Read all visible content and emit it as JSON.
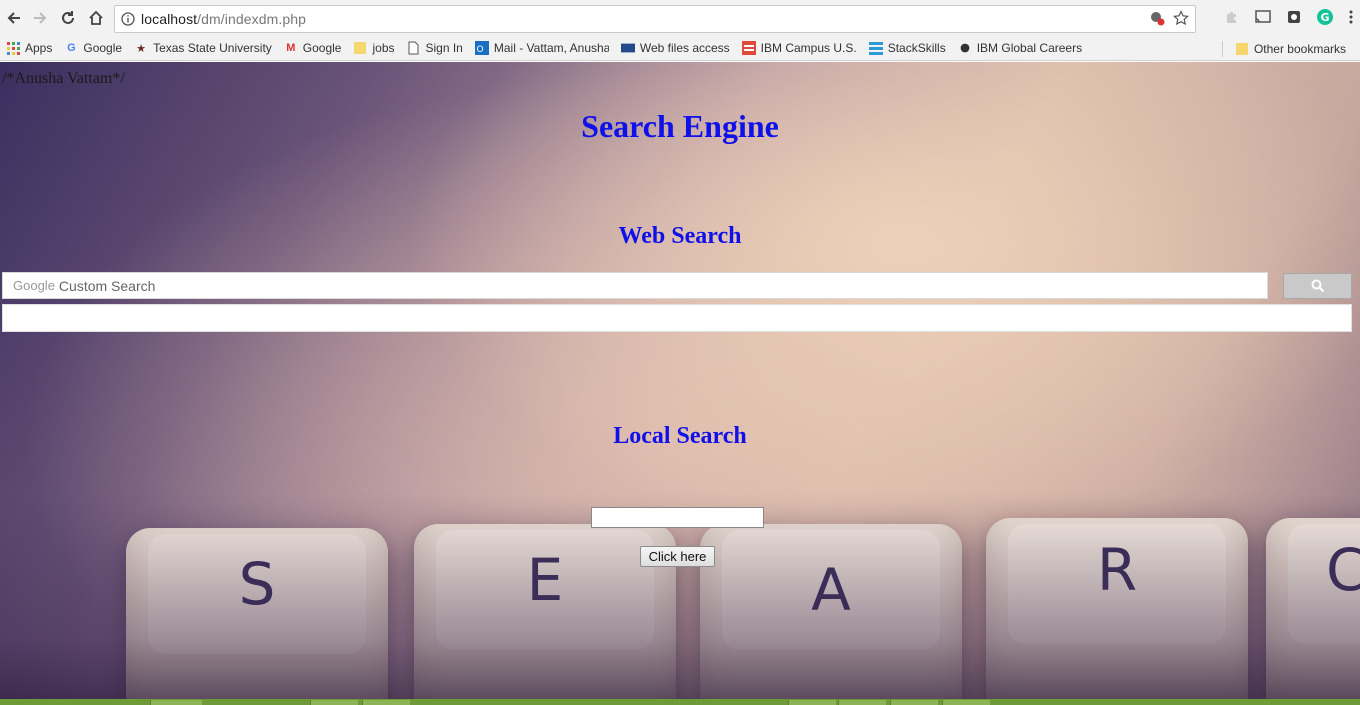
{
  "browser": {
    "url_host": "localhost",
    "url_path": "/dm/indexdm.php"
  },
  "bookmarks": [
    {
      "label": "Apps",
      "icon": "apps-grid-icon"
    },
    {
      "label": "Google",
      "icon": "google-g-icon"
    },
    {
      "label": "Texas State University",
      "icon": "star-icon"
    },
    {
      "label": "Google",
      "icon": "gmail-icon"
    },
    {
      "label": "jobs",
      "icon": "folder-icon"
    },
    {
      "label": "Sign In",
      "icon": "page-icon"
    },
    {
      "label": "Mail - Vattam, Anusha",
      "icon": "outlook-icon"
    },
    {
      "label": "Web files access",
      "icon": "wfa-icon"
    },
    {
      "label": "IBM Campus U.S.",
      "icon": "ibm-campus-icon"
    },
    {
      "label": "StackSkills",
      "icon": "stackskills-icon"
    },
    {
      "label": "IBM Global Careers",
      "icon": "ibm-careers-icon"
    }
  ],
  "other_bookmarks": "Other bookmarks",
  "page": {
    "comment": "/*Anusha Vattam*/",
    "title": "Search Engine",
    "web_search_title": "Web Search",
    "cse_google": "Google",
    "cse_placeholder": "Custom Search",
    "local_search_title": "Local Search",
    "local_input_value": "",
    "click_button": "Click here",
    "key_letters": [
      "S",
      "E",
      "A",
      "R",
      "C"
    ]
  },
  "colors": {
    "heading": "#1010e8",
    "taskbar": "#6f9a38"
  }
}
